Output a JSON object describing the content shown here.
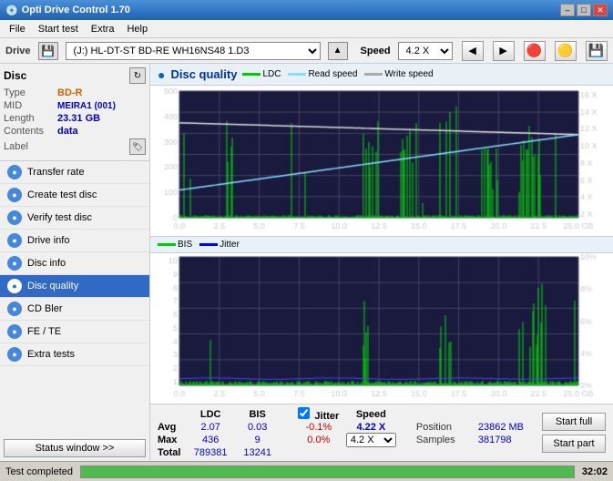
{
  "window": {
    "title": "Opti Drive Control 1.70",
    "icon": "disc-icon"
  },
  "title_buttons": {
    "minimize": "–",
    "maximize": "□",
    "close": "✕"
  },
  "menu": {
    "items": [
      "File",
      "Start test",
      "Extra",
      "Help"
    ]
  },
  "drive": {
    "label": "Drive",
    "selected": "(J:)  HL-DT-ST BD-RE  WH16NS48 1.D3",
    "speed_label": "Speed",
    "speed_selected": "4.2 X"
  },
  "disc": {
    "title": "Disc",
    "type_label": "Type",
    "type_value": "BD-R",
    "mid_label": "MID",
    "mid_value": "MEIRA1 (001)",
    "length_label": "Length",
    "length_value": "23.31 GB",
    "contents_label": "Contents",
    "contents_value": "data",
    "label_label": "Label"
  },
  "nav": {
    "items": [
      {
        "id": "transfer-rate",
        "label": "Transfer rate",
        "active": false
      },
      {
        "id": "create-test-disc",
        "label": "Create test disc",
        "active": false
      },
      {
        "id": "verify-test-disc",
        "label": "Verify test disc",
        "active": false
      },
      {
        "id": "drive-info",
        "label": "Drive info",
        "active": false
      },
      {
        "id": "disc-info",
        "label": "Disc info",
        "active": false
      },
      {
        "id": "disc-quality",
        "label": "Disc quality",
        "active": true
      },
      {
        "id": "cd-bler",
        "label": "CD Bler",
        "active": false
      },
      {
        "id": "fe-te",
        "label": "FE / TE",
        "active": false
      },
      {
        "id": "extra-tests",
        "label": "Extra tests",
        "active": false
      }
    ],
    "status_btn": "Status window >>"
  },
  "content": {
    "title": "Disc quality",
    "legend": {
      "ldc": {
        "label": "LDC",
        "color": "#00aa00"
      },
      "read_speed": {
        "label": "Read speed",
        "color": "#88ddff"
      },
      "write_speed": {
        "label": "Write speed",
        "color": "white"
      },
      "bis": {
        "label": "BIS",
        "color": "#00aa00"
      },
      "jitter": {
        "label": "Jitter",
        "color": "#0000ff"
      }
    }
  },
  "stats": {
    "ldc_header": "LDC",
    "bis_header": "BIS",
    "jitter_header": "Jitter",
    "speed_header": "Speed",
    "avg_label": "Avg",
    "max_label": "Max",
    "total_label": "Total",
    "ldc_avg": "2.07",
    "ldc_max": "436",
    "ldc_total": "789381",
    "bis_avg": "0.03",
    "bis_max": "9",
    "bis_total": "13241",
    "jitter_avg": "-0.1%",
    "jitter_max": "0.0%",
    "speed_value": "4.22 X",
    "speed_label2": "4.2 X",
    "position_label": "Position",
    "position_value": "23862 MB",
    "samples_label": "Samples",
    "samples_value": "381798",
    "jitter_checked": true,
    "jitter_checkbox_label": "Jitter",
    "start_full_btn": "Start full",
    "start_part_btn": "Start part"
  },
  "status_bar": {
    "text": "Test completed",
    "progress": 100,
    "time": "32:02"
  },
  "chart1": {
    "y_labels_right": [
      "16 X",
      "14 X",
      "12 X",
      "10 X",
      "8 X",
      "6 X",
      "4 X",
      "2 X"
    ],
    "y_labels_left": [
      "500",
      "400",
      "300",
      "200",
      "100"
    ],
    "x_labels": [
      "0.0",
      "2.5",
      "5.0",
      "7.5",
      "10.0",
      "12.5",
      "15.0",
      "17.5",
      "20.0",
      "22.5",
      "25.0 GB"
    ]
  },
  "chart2": {
    "y_labels_right": [
      "10%",
      "8%",
      "6%",
      "4%",
      "2%"
    ],
    "y_labels_left": [
      "10",
      "9",
      "8",
      "7",
      "6",
      "5",
      "4",
      "3",
      "2",
      "1"
    ],
    "x_labels": [
      "0.0",
      "2.5",
      "5.0",
      "7.5",
      "10.0",
      "12.5",
      "15.0",
      "17.5",
      "20.0",
      "22.5",
      "25.0 GB"
    ]
  }
}
